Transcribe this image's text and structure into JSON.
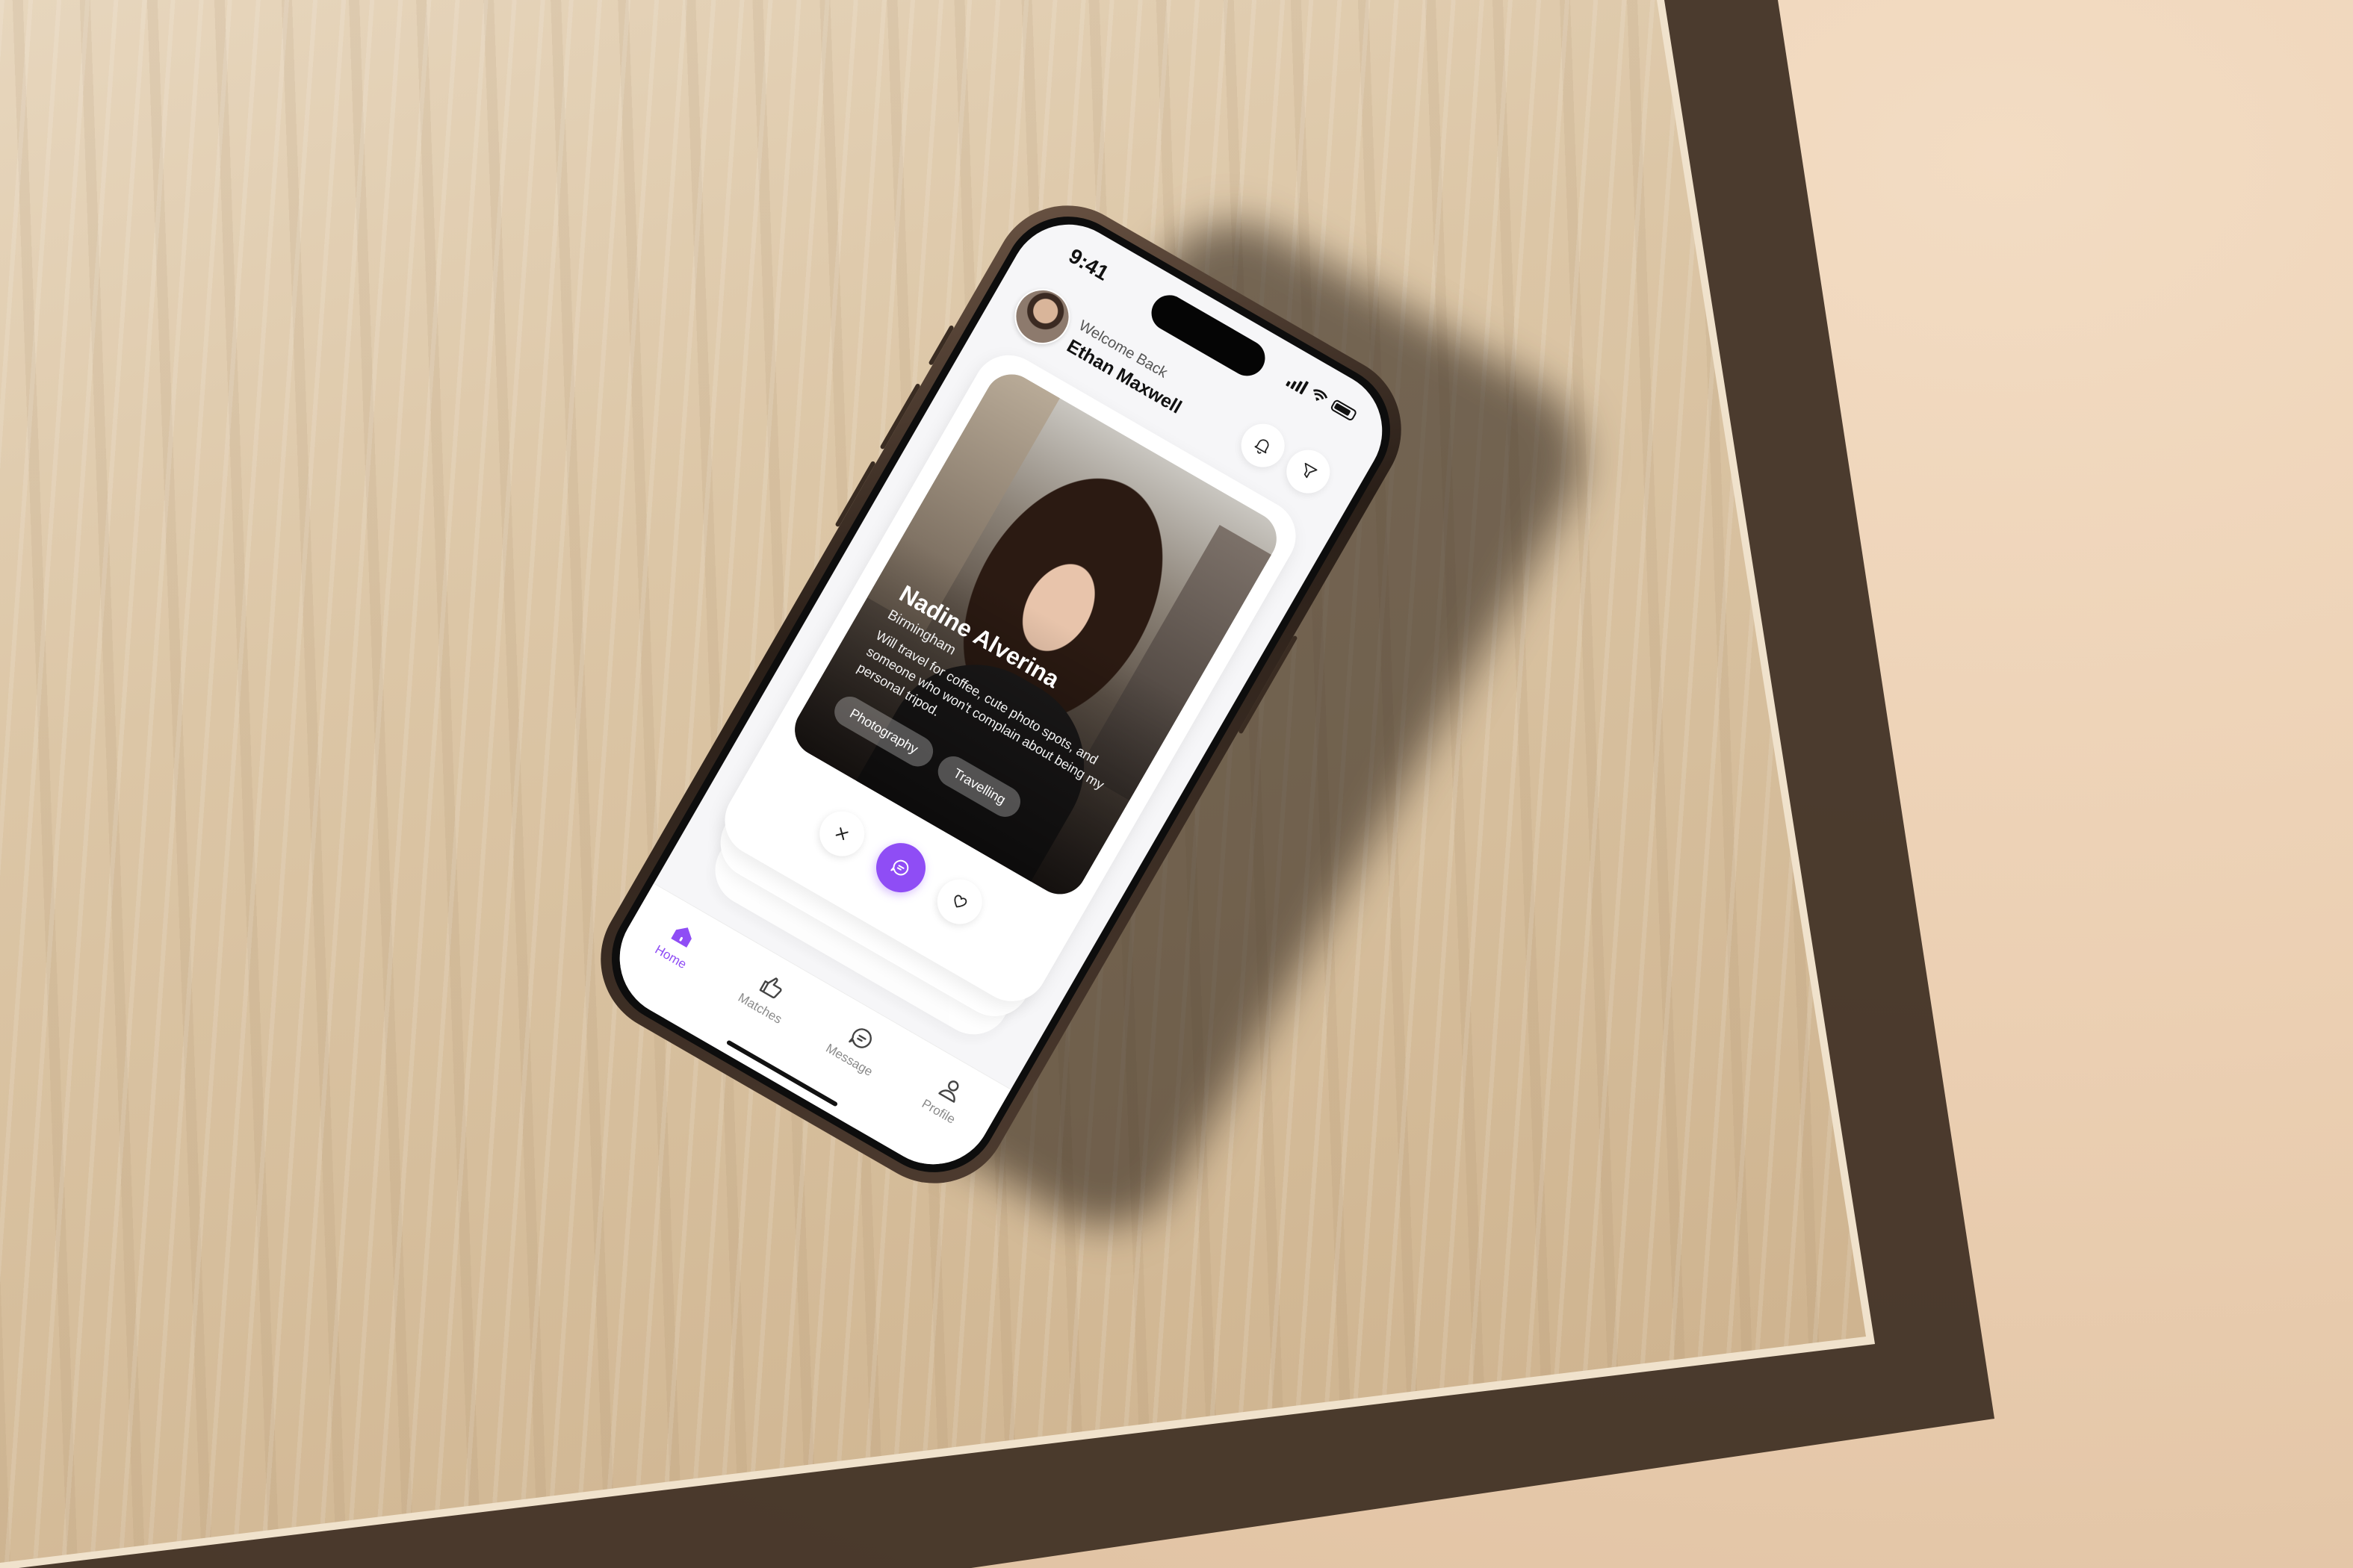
{
  "status_bar": {
    "time": "9:41",
    "icons": [
      "signal-icon",
      "wifi-icon",
      "battery-icon"
    ]
  },
  "header": {
    "greeting": "Welcome Back",
    "user_name": "Ethan Maxwell",
    "buttons": [
      "bell-icon",
      "filter-icon"
    ]
  },
  "profile_card": {
    "name": "Nadine Alverina",
    "location": "Birmingham",
    "bio": "Will travel for coffee, cute photo spots, and someone who won't complain about being my personal tripod.",
    "tags": [
      "Photography",
      "Travelling"
    ]
  },
  "actions": {
    "dismiss_icon": "close-icon",
    "message_icon": "chat-icon",
    "like_icon": "heart-icon"
  },
  "nav": {
    "items": [
      {
        "label": "Home",
        "icon": "home-icon",
        "active": true
      },
      {
        "label": "Matches",
        "icon": "thumbs-up-icon",
        "active": false
      },
      {
        "label": "Message",
        "icon": "message-icon",
        "active": false
      },
      {
        "label": "Profile",
        "icon": "person-icon",
        "active": false
      }
    ]
  },
  "colors": {
    "accent": "#8f4df5",
    "background": "#f6f6f8",
    "text": "#111111"
  }
}
